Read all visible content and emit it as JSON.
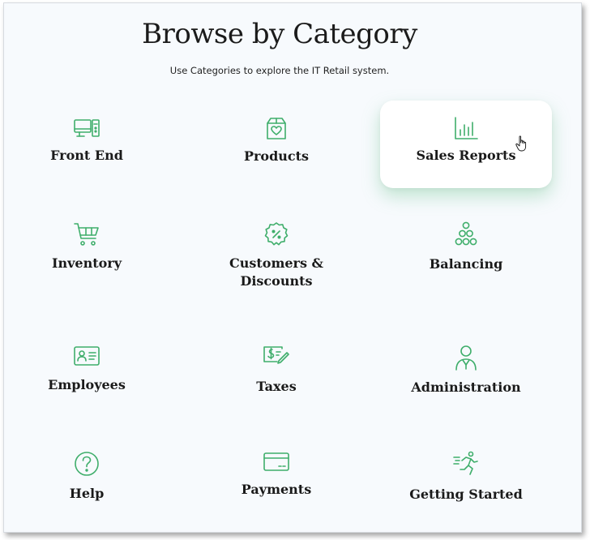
{
  "page": {
    "title": "Browse by Category",
    "subtitle": "Use Categories to explore the IT Retail system."
  },
  "accent_color": "#3fae6b",
  "categories": [
    {
      "label": "Front End",
      "icon": "pos-terminal-icon"
    },
    {
      "label": "Products",
      "icon": "product-box-icon"
    },
    {
      "label": "Sales Reports",
      "icon": "bar-chart-icon"
    },
    {
      "label": "Inventory",
      "icon": "shopping-cart-icon"
    },
    {
      "label": "Customers &",
      "label2": "Discounts",
      "icon": "discount-badge-icon"
    },
    {
      "label": "Balancing",
      "icon": "coin-stack-icon"
    },
    {
      "label": "Employees",
      "icon": "id-card-icon"
    },
    {
      "label": "Taxes",
      "icon": "tax-form-icon"
    },
    {
      "label": "Administration",
      "icon": "admin-user-icon"
    },
    {
      "label": "Help",
      "icon": "question-icon"
    },
    {
      "label": "Payments",
      "icon": "credit-card-icon"
    },
    {
      "label": "Getting Started",
      "icon": "running-person-icon"
    }
  ]
}
